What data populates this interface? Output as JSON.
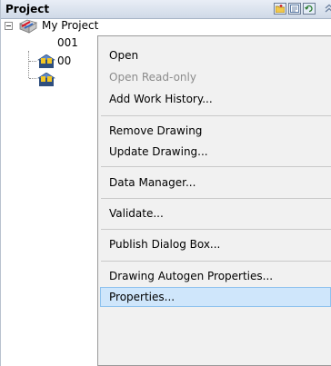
{
  "panel": {
    "title": "Project",
    "header_buttons": [
      {
        "icon": "new-folder-icon"
      },
      {
        "icon": "add-item-icon"
      },
      {
        "icon": "refresh-icon"
      }
    ],
    "collapse_icon": "chevron-up-icon"
  },
  "tree": {
    "root": {
      "label": "My Project",
      "icon": "project-icon",
      "expanded": true
    },
    "children": [
      {
        "label": "001",
        "icon": "drawing-icon"
      },
      {
        "label": "00",
        "icon": "drawing-icon"
      }
    ]
  },
  "context_menu": {
    "items": [
      {
        "label": "Open",
        "disabled": false
      },
      {
        "label": "Open Read-only",
        "disabled": true
      },
      {
        "label": "Add Work History...",
        "disabled": false
      },
      {
        "label": "Remove Drawing",
        "disabled": false
      },
      {
        "label": "Update Drawing...",
        "disabled": false
      },
      {
        "label": "Data Manager...",
        "disabled": false
      },
      {
        "label": "Validate...",
        "disabled": false
      },
      {
        "label": "Publish Dialog Box...",
        "disabled": false
      },
      {
        "label": "Drawing Autogen Properties...",
        "disabled": false
      },
      {
        "label": "Properties...",
        "disabled": false,
        "selected": true
      }
    ]
  }
}
